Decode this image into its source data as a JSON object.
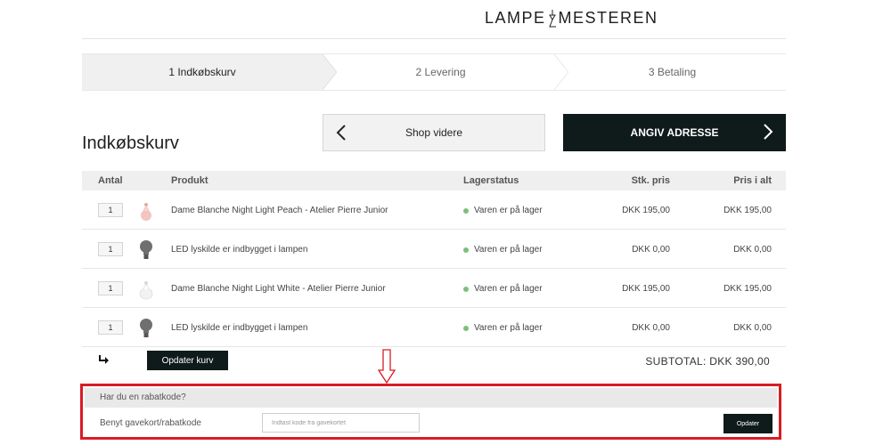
{
  "header": {
    "logo_left": "LAMPE",
    "logo_right": "MESTEREN"
  },
  "steps": [
    {
      "label": "1  Indkøbskurv",
      "active": true
    },
    {
      "label": "2  Levering",
      "active": false
    },
    {
      "label": "3  Betaling",
      "active": false
    }
  ],
  "cart": {
    "title": "Indkøbskurv",
    "continue_shopping_label": "Shop videre",
    "address_button_label": "ANGIV ADRESSE"
  },
  "table": {
    "headers": {
      "qty": "Antal",
      "product": "Produkt",
      "stock": "Lagerstatus",
      "unit_price": "Stk. pris",
      "total_price": "Pris i alt"
    },
    "rows": [
      {
        "qty": "1",
        "icon": "night-light-peach-icon",
        "product": "Dame Blanche Night Light Peach - Atelier Pierre Junior",
        "stock": "Varen er på lager",
        "unit_price": "DKK 195,00",
        "total_price": "DKK 195,00"
      },
      {
        "qty": "1",
        "icon": "light-bulb-icon",
        "product": "LED lyskilde er indbygget i lampen",
        "stock": "Varen er på lager",
        "unit_price": "DKK 0,00",
        "total_price": "DKK 0,00"
      },
      {
        "qty": "1",
        "icon": "night-light-white-icon",
        "product": "Dame Blanche Night Light White - Atelier Pierre Junior",
        "stock": "Varen er på lager",
        "unit_price": "DKK 195,00",
        "total_price": "DKK 195,00"
      },
      {
        "qty": "1",
        "icon": "light-bulb-icon",
        "product": "LED lyskilde er indbygget i lampen",
        "stock": "Varen er på lager",
        "unit_price": "DKK 0,00",
        "total_price": "DKK 0,00"
      }
    ]
  },
  "footer": {
    "update_cart_label": "Opdater kurv",
    "subtotal": "SUBTOTAL: DKK 390,00"
  },
  "discount": {
    "heading": "Har du en rabatkode?",
    "label": "Benyt gavekort/rabatkode",
    "input_placeholder": "Indtast kode fra gavekortet",
    "apply_label": "Opdater"
  },
  "colors": {
    "dark_button": "#0f1a1a",
    "highlight_frame": "#d91c24",
    "in_stock_dot": "#7cbf7c"
  }
}
